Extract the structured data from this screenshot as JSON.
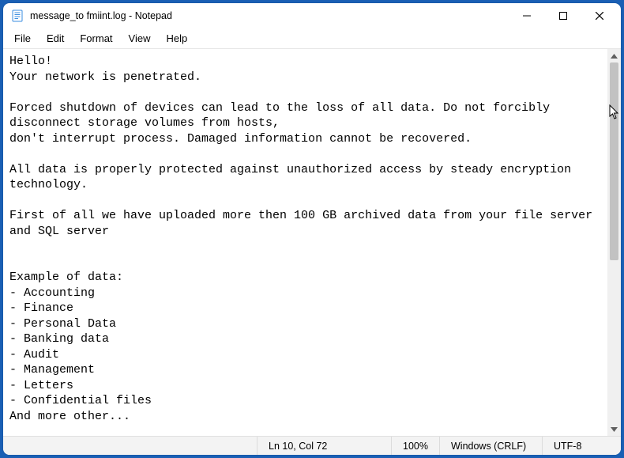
{
  "window": {
    "title": "message_to fmiint.log - Notepad"
  },
  "menu": {
    "file": "File",
    "edit": "Edit",
    "format": "Format",
    "view": "View",
    "help": "Help"
  },
  "document": {
    "text": "Hello!\nYour network is penetrated.\n\nForced shutdown of devices can lead to the loss of all data. Do not forcibly disconnect storage volumes from hosts,\ndon't interrupt process. Damaged information cannot be recovered.\n\nAll data is properly protected against unauthorized access by steady encryption technology.\n\nFirst of all we have uploaded more then 100 GB archived data from your file server and SQL server\n\n\nExample of data:\n- Accounting\n- Finance\n- Personal Data\n- Banking data\n- Audit\n- Management\n- Letters\n- Confidential files\nAnd more other..."
  },
  "status": {
    "position": "Ln 10, Col 72",
    "zoom": "100%",
    "line_ending": "Windows (CRLF)",
    "encoding": "UTF-8"
  }
}
